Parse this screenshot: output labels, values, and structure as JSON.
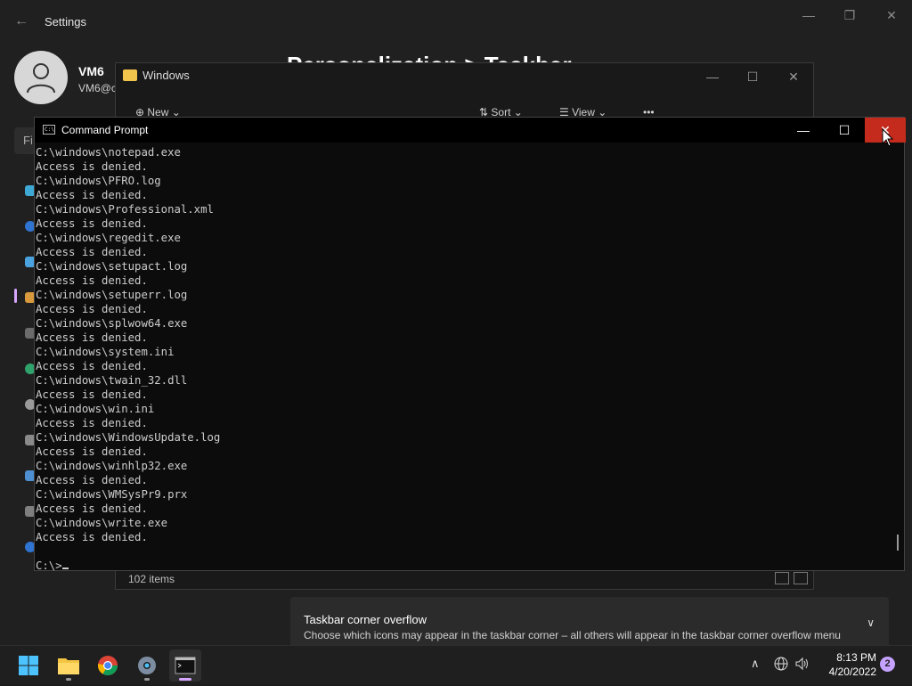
{
  "settings": {
    "title": "Settings",
    "user_name": "VM6",
    "user_email": "VM6@c",
    "page_heading": "Personalization > Taskbar",
    "find_placeholder": "Fi",
    "overflow_title": "Taskbar corner overflow",
    "overflow_desc": "Choose which icons may appear in the taskbar corner – all others will appear in the taskbar corner overflow menu"
  },
  "explorer": {
    "title": "Windows",
    "toolbar": {
      "new_label": "New",
      "sort_label": "Sort",
      "view_label": "View",
      "more_label": "•••"
    },
    "status_items": "102 items"
  },
  "cmd": {
    "title": "Command Prompt",
    "lines": [
      "C:\\windows\\notepad.exe",
      "Access is denied.",
      "C:\\windows\\PFRO.log",
      "Access is denied.",
      "C:\\windows\\Professional.xml",
      "Access is denied.",
      "C:\\windows\\regedit.exe",
      "Access is denied.",
      "C:\\windows\\setupact.log",
      "Access is denied.",
      "C:\\windows\\setuperr.log",
      "Access is denied.",
      "C:\\windows\\splwow64.exe",
      "Access is denied.",
      "C:\\windows\\system.ini",
      "Access is denied.",
      "C:\\windows\\twain_32.dll",
      "Access is denied.",
      "C:\\windows\\win.ini",
      "Access is denied.",
      "C:\\windows\\WindowsUpdate.log",
      "Access is denied.",
      "C:\\windows\\winhlp32.exe",
      "Access is denied.",
      "C:\\windows\\WMSysPr9.prx",
      "Access is denied.",
      "C:\\windows\\write.exe",
      "Access is denied.",
      ""
    ],
    "prompt": "C:\\>"
  },
  "taskbar": {
    "apps": [
      "start-icon",
      "file-explorer-icon",
      "chrome-icon",
      "settings-icon",
      "command-prompt-icon"
    ],
    "time": "8:13 PM",
    "date": "4/20/2022",
    "notification_count": "2"
  },
  "colors": {
    "close_hover": "#c42b1c",
    "accent": "#d7a6ff",
    "console_bg": "#0c0c0c",
    "console_fg": "#cccccc"
  }
}
